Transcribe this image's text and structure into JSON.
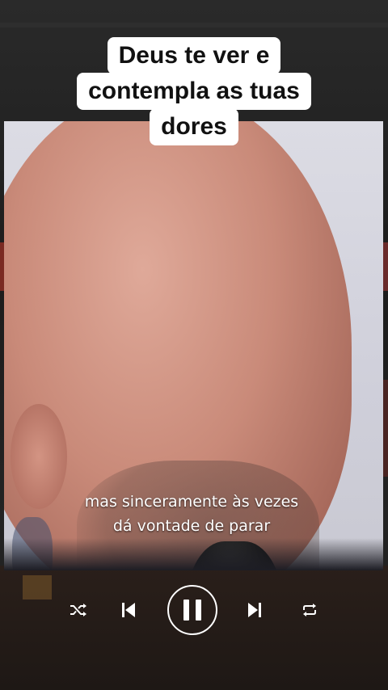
{
  "overlay": {
    "title_lines": [
      "Deus te ver e",
      "contempla as tuas",
      "dores"
    ]
  },
  "video": {
    "subtitle_lines": [
      "mas sinceramente às vezes",
      "dá vontade de parar"
    ]
  },
  "player": {
    "icons": {
      "shuffle": "shuffle-icon",
      "previous": "skip-previous-icon",
      "play_pause": "pause-icon",
      "next": "skip-next-icon",
      "repeat": "repeat-icon"
    }
  },
  "colors": {
    "title_bg": "#ffffff",
    "title_text": "#111111",
    "controls": "#ffffff",
    "background": "#1a1a1a"
  }
}
